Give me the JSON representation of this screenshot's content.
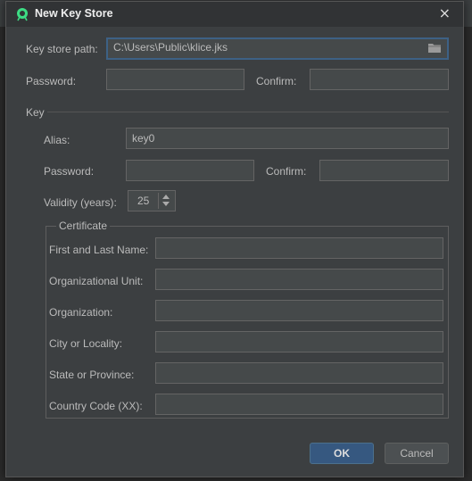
{
  "window": {
    "title": "New Key Store",
    "close_glyph": "×"
  },
  "keystore": {
    "path_label": "Key store path:",
    "path_value": "C:\\Users\\Public\\klice.jks",
    "password_label": "Password:",
    "password_value": "",
    "confirm_label": "Confirm:",
    "confirm_value": ""
  },
  "key": {
    "section_label": "Key",
    "alias_label": "Alias:",
    "alias_value": "key0",
    "password_label": "Password:",
    "password_value": "",
    "confirm_label": "Confirm:",
    "confirm_value": "",
    "validity_label": "Validity (years):",
    "validity_value": "25"
  },
  "certificate": {
    "legend": "Certificate",
    "fields": [
      {
        "label": "First and Last Name:",
        "value": ""
      },
      {
        "label": "Organizational Unit:",
        "value": ""
      },
      {
        "label": "Organization:",
        "value": ""
      },
      {
        "label": "City or Locality:",
        "value": ""
      },
      {
        "label": "State or Province:",
        "value": ""
      },
      {
        "label": "Country Code (XX):",
        "value": ""
      }
    ]
  },
  "buttons": {
    "ok_label": "OK",
    "cancel_label": "Cancel"
  },
  "icons": {
    "app": "android-studio-icon",
    "browse": "folder-icon",
    "close": "close-icon"
  },
  "colors": {
    "primary_button": "#365880",
    "focus_border": "#3d6185",
    "dialog_bg": "#3c3f41"
  }
}
